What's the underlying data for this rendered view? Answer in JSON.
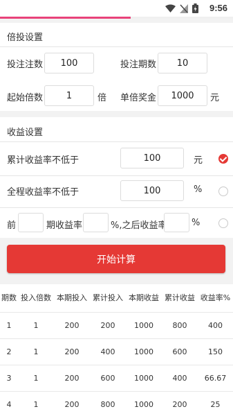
{
  "status": {
    "time": "9:56",
    "progress": 0.56
  },
  "bet_section": {
    "title": "倍投设置",
    "bet_count_label": "投注注数",
    "bet_count_value": "100",
    "periods_label": "投注期数",
    "periods_value": "10",
    "start_mult_label": "起始倍数",
    "start_mult_value": "1",
    "mult_unit": "倍",
    "unit_prize_label": "单倍奖金",
    "unit_prize_value": "1000",
    "prize_unit": "元"
  },
  "profit_section": {
    "title": "收益设置",
    "option1_label": "累计收益率不低于",
    "option1_value": "100",
    "option1_unit": "元",
    "option1_checked": true,
    "option2_label": "全程收益率不低于",
    "option2_value": "100",
    "option2_unit": "%",
    "option2_checked": false,
    "option3_prefix": "前",
    "option3_periods_value": "",
    "option3_mid": "期收益率",
    "option3_rate_value": "",
    "option3_after": "%,之后收益率",
    "option3_after_value": "",
    "option3_unit": "%",
    "option3_checked": false
  },
  "start_button_label": "开始计算",
  "table": {
    "headers": [
      "期数",
      "投入倍数",
      "本期投入",
      "累计投入",
      "本期收益",
      "累计收益",
      "收益率%"
    ],
    "rows": [
      [
        "1",
        "1",
        "200",
        "200",
        "1000",
        "800",
        "400"
      ],
      [
        "2",
        "1",
        "200",
        "400",
        "1000",
        "600",
        "150"
      ],
      [
        "3",
        "1",
        "200",
        "600",
        "1000",
        "400",
        "66.67"
      ],
      [
        "4",
        "1",
        "200",
        "800",
        "1000",
        "200",
        "25"
      ]
    ]
  }
}
